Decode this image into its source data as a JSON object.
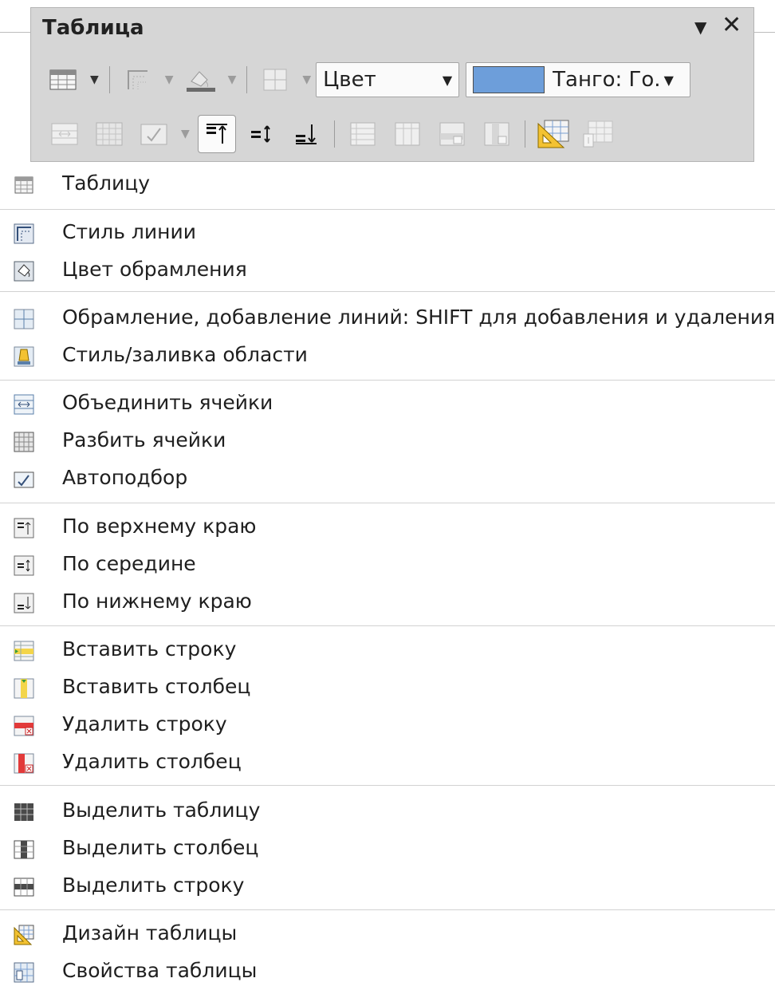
{
  "toolbar": {
    "title": "Таблица",
    "menu_glyph": "▼",
    "close_glyph": "✕",
    "border_color_combo": "Цвет",
    "area_fill_combo": "Танго: Го.",
    "swatch_color": "#6d9eda"
  },
  "menu": {
    "sections": [
      {
        "items": [
          {
            "label": "Таблицу",
            "icon": "table-icon"
          }
        ]
      },
      {
        "items": [
          {
            "label": "Стиль линии",
            "icon": "line-style-icon"
          },
          {
            "label": "Цвет обрамления",
            "icon": "border-color-icon"
          }
        ]
      },
      {
        "items": [
          {
            "label": "Обрамление, добавление линий: SHIFT для добавления и удаления",
            "icon": "borders-icon"
          },
          {
            "label": "Стиль/заливка области",
            "icon": "area-fill-icon"
          }
        ]
      },
      {
        "items": [
          {
            "label": "Объединить ячейки",
            "icon": "merge-cells-icon"
          },
          {
            "label": "Разбить ячейки",
            "icon": "split-cells-icon"
          },
          {
            "label": "Автоподбор",
            "icon": "autofit-icon"
          }
        ]
      },
      {
        "items": [
          {
            "label": "По верхнему краю",
            "icon": "align-top-icon"
          },
          {
            "label": "По середине",
            "icon": "align-middle-icon"
          },
          {
            "label": "По нижнему краю",
            "icon": "align-bottom-icon"
          }
        ]
      },
      {
        "items": [
          {
            "label": "Вставить строку",
            "icon": "insert-row-icon"
          },
          {
            "label": "Вставить столбец",
            "icon": "insert-column-icon"
          },
          {
            "label": "Удалить строку",
            "icon": "delete-row-icon"
          },
          {
            "label": "Удалить столбец",
            "icon": "delete-column-icon"
          }
        ]
      },
      {
        "items": [
          {
            "label": "Выделить таблицу",
            "icon": "select-table-icon"
          },
          {
            "label": "Выделить столбец",
            "icon": "select-column-icon"
          },
          {
            "label": "Выделить строку",
            "icon": "select-row-icon"
          }
        ]
      },
      {
        "items": [
          {
            "label": "Дизайн таблицы",
            "icon": "table-design-icon"
          },
          {
            "label": "Свойства таблицы",
            "icon": "table-properties-icon"
          }
        ]
      }
    ]
  }
}
